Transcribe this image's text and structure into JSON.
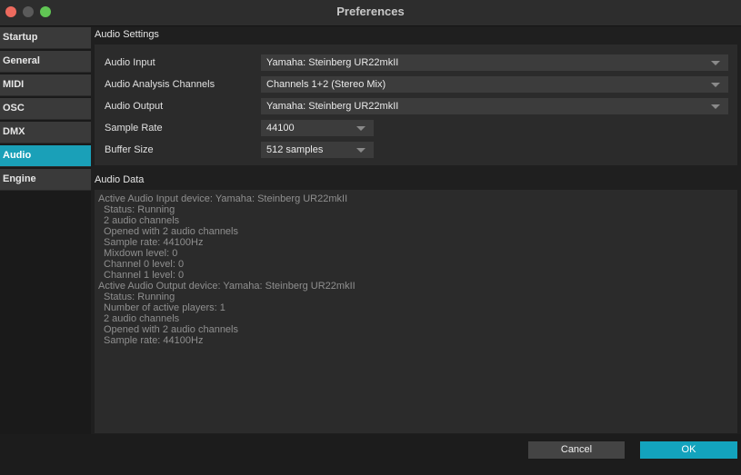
{
  "window": {
    "title": "Preferences"
  },
  "sidebar": {
    "items": [
      {
        "label": "Startup"
      },
      {
        "label": "General"
      },
      {
        "label": "MIDI"
      },
      {
        "label": "OSC"
      },
      {
        "label": "DMX"
      },
      {
        "label": "Audio",
        "active": true
      },
      {
        "label": "Engine"
      }
    ]
  },
  "audio_settings": {
    "header": "Audio Settings",
    "rows": [
      {
        "label": "Audio Input",
        "value": "Yamaha: Steinberg UR22mkII"
      },
      {
        "label": "Audio Analysis Channels",
        "value": "Channels 1+2 (Stereo Mix)"
      },
      {
        "label": "Audio Output",
        "value": "Yamaha: Steinberg UR22mkII"
      },
      {
        "label": "Sample Rate",
        "value": "44100"
      },
      {
        "label": "Buffer Size",
        "value": "512 samples"
      }
    ]
  },
  "audio_data": {
    "header": "Audio Data",
    "lines": [
      "Active Audio Input device: Yamaha: Steinberg UR22mkII",
      "Status: Running",
      "2 audio channels",
      "Opened with 2 audio channels",
      "Sample rate: 44100Hz",
      "Mixdown level: 0",
      "Channel 0 level: 0",
      "Channel 1 level: 0",
      "Active Audio Output device: Yamaha: Steinberg UR22mkII",
      "Status: Running",
      "Number of active players: 1",
      "2 audio channels",
      "Opened with 2 audio channels",
      "Sample rate: 44100Hz"
    ]
  },
  "footer": {
    "cancel_label": "Cancel",
    "ok_label": "OK"
  },
  "colors": {
    "accent": "#13a3bd"
  }
}
